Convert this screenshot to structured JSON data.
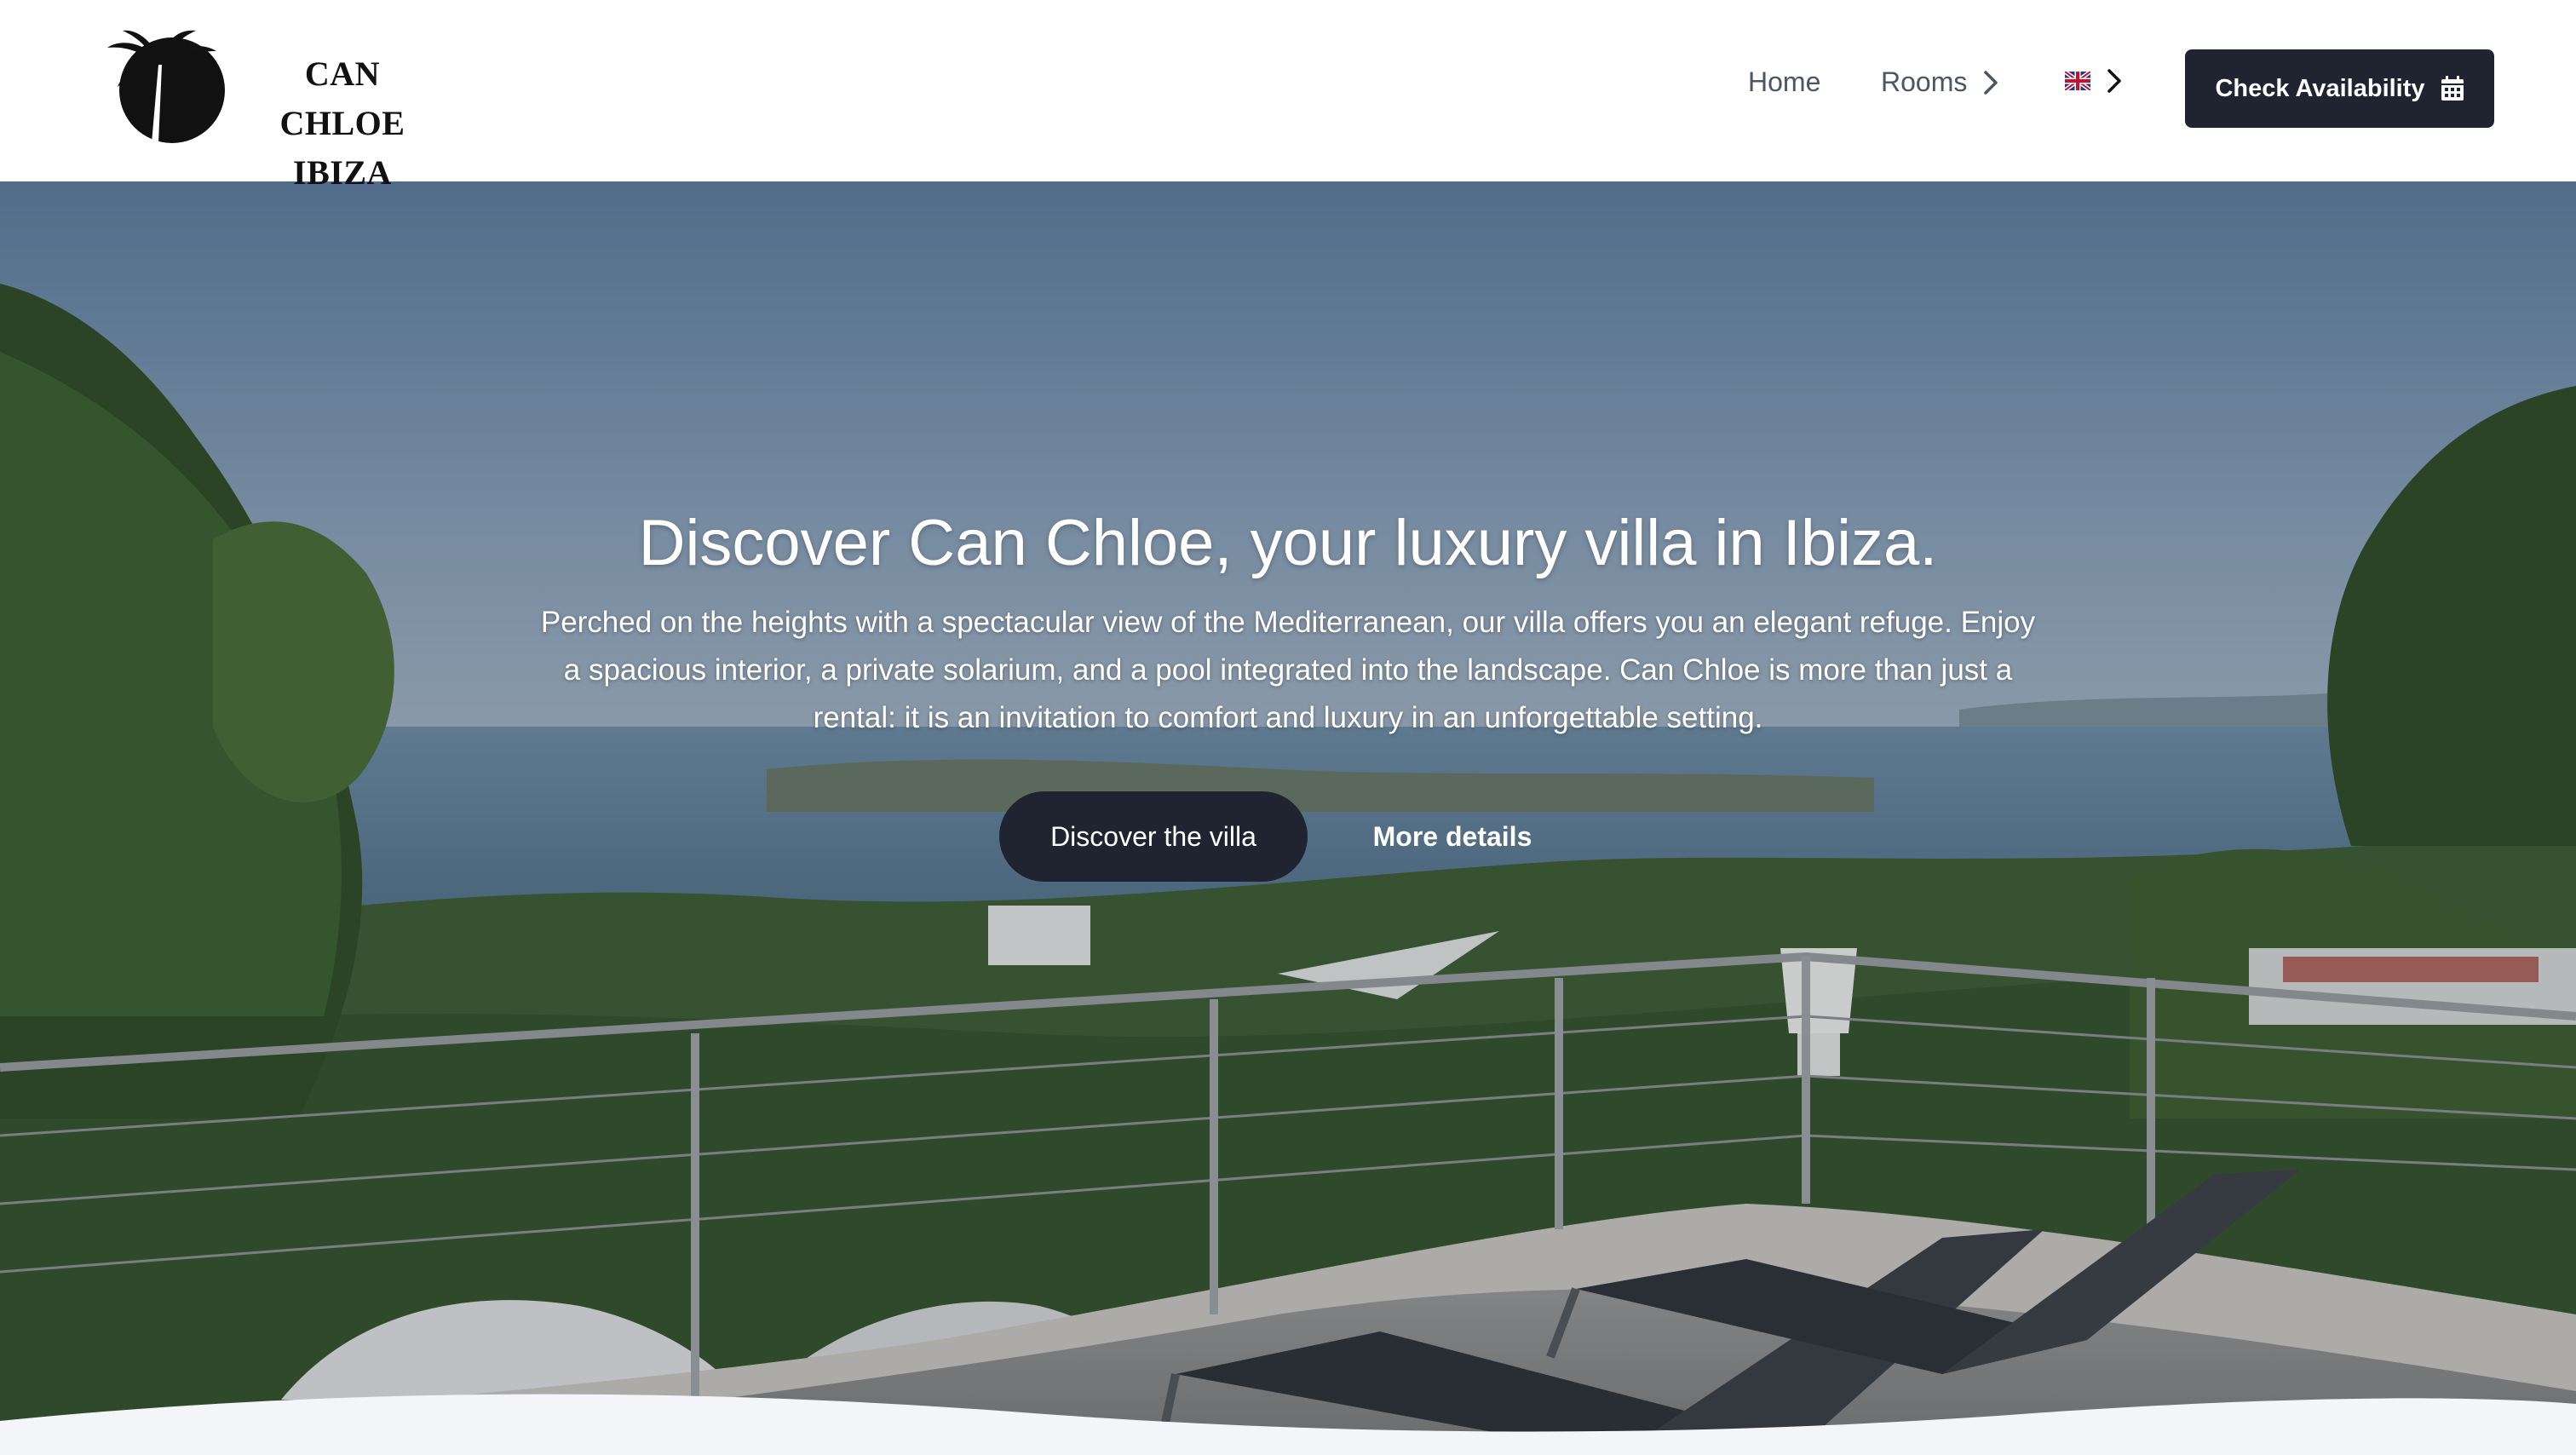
{
  "brand": {
    "line1": "CAN CHLOE",
    "line2": "IBIZA",
    "logo_icon": "palm-tree-sun-icon"
  },
  "nav": {
    "home": "Home",
    "rooms": "Rooms",
    "language_flag": "uk-flag-icon"
  },
  "header": {
    "cta_label": "Check Availability",
    "cta_icon": "calendar-icon"
  },
  "hero": {
    "title": "Discover Can Chloe, your luxury villa in Ibiza.",
    "description": "Perched on the heights with a spectacular view of the Mediterranean, our villa offers you an elegant refuge. Enjoy a spacious interior, a private solarium, and a pool integrated into the landscape. Can Chloe is more than just a rental: it is an invitation to comfort and luxury in an unforgettable setting.",
    "primary_button": "Discover the villa",
    "secondary_button": "More details"
  },
  "colors": {
    "dark_button": "#1f2430",
    "nav_text": "#4b5563",
    "section_bg": "#f3f5f9"
  }
}
